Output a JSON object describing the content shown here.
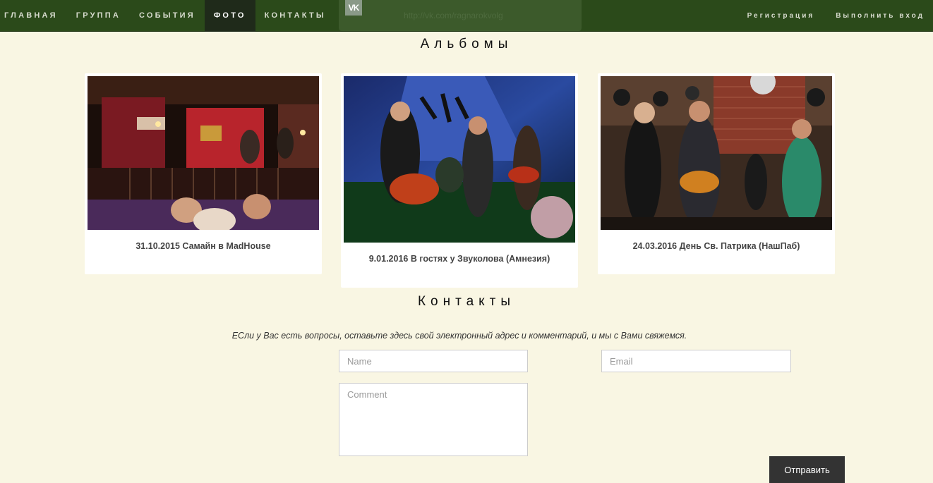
{
  "nav": {
    "items": [
      {
        "label": "ГЛАВНАЯ"
      },
      {
        "label": "ГРУППА"
      },
      {
        "label": "СОБЫТИЯ"
      },
      {
        "label": "ФОТО",
        "active": true
      },
      {
        "label": "КОНТАКТЫ"
      }
    ],
    "vk_icon_text": "VK",
    "vk_link": "http://vk.com/ragnarokvolg",
    "register": "Регистрация",
    "login": "Выполнить вход"
  },
  "albums": {
    "title": "Альбомы",
    "items": [
      {
        "caption": "31.10.2015 Самайн в MadHouse"
      },
      {
        "caption": "9.01.2016 В гостях у Звуколова (Амнезия)"
      },
      {
        "caption": "24.03.2016 День Св. Патрика (НашПаб)"
      }
    ]
  },
  "contacts": {
    "title": "Контакты",
    "description": "ЕСли у Вас есть вопросы, оставьте здесь свой электронный адрес и комментарий, и мы с Вами свяжемся.",
    "name_placeholder": "Name",
    "email_placeholder": "Email",
    "comment_placeholder": "Comment",
    "submit_label": "Отправить"
  },
  "colors": {
    "navbar": "#2b4a1a",
    "page_background": "#f9f6e3",
    "active_nav": "#1f2a1a",
    "submit_button": "#333333"
  }
}
